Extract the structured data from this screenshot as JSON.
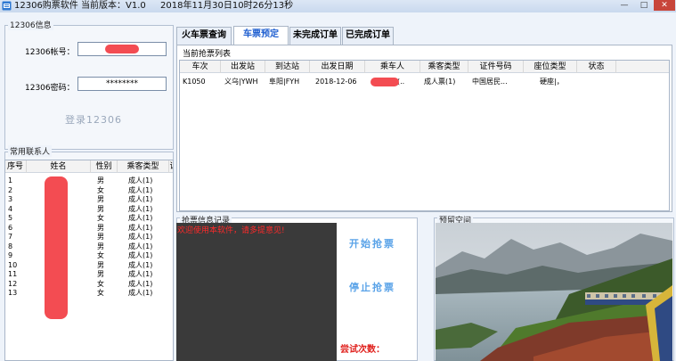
{
  "window": {
    "title": "12306购票软件 当前版本：V1.0",
    "datetime": "2018年11月30日10时26分13秒",
    "min": "—",
    "max": "□",
    "close": "✕"
  },
  "login": {
    "group_title": "12306信息",
    "account_label": "12306帐号：",
    "password_label": "12306密码：",
    "password_value": "********",
    "login_button": "登录12306"
  },
  "contacts": {
    "group_title": "常用联系人",
    "headers": [
      "序号",
      "姓名",
      "性别",
      "乘客类型",
      "证"
    ],
    "rows": [
      {
        "no": "1",
        "gender": "男",
        "type": "成人(1)"
      },
      {
        "no": "2",
        "gender": "女",
        "type": "成人(1)"
      },
      {
        "no": "3",
        "gender": "男",
        "type": "成人(1)"
      },
      {
        "no": "4",
        "gender": "男",
        "type": "成人(1)"
      },
      {
        "no": "5",
        "gender": "女",
        "type": "成人(1)"
      },
      {
        "no": "6",
        "gender": "男",
        "type": "成人(1)"
      },
      {
        "no": "7",
        "gender": "男",
        "type": "成人(1)"
      },
      {
        "no": "8",
        "gender": "男",
        "type": "成人(1)"
      },
      {
        "no": "9",
        "gender": "女",
        "type": "成人(1)"
      },
      {
        "no": "10",
        "gender": "男",
        "type": "成人(1)"
      },
      {
        "no": "11",
        "gender": "男",
        "type": "成人(1)"
      },
      {
        "no": "12",
        "gender": "女",
        "type": "成人(1)"
      },
      {
        "no": "13",
        "gender": "女",
        "type": "成人(1)"
      }
    ]
  },
  "tabs": [
    {
      "label": "火车票查询"
    },
    {
      "label": "车票预定"
    },
    {
      "label": "未完成订单"
    },
    {
      "label": "已完成订单"
    }
  ],
  "booking": {
    "list_title": "当前抢票列表",
    "headers": [
      "车次",
      "出发站",
      "到达站",
      "出发日期",
      "乘车人",
      "乘客类型",
      "证件号码",
      "座位类型",
      "状态"
    ],
    "row": {
      "train": "K1050",
      "from": "义乌|YWH",
      "to": "阜阳|FYH",
      "date": "2018-12-06",
      "passenger": "(..",
      "ptype": "成人票(1)",
      "idtype": "中国居民...",
      "seat": "硬座|，",
      "status": ""
    }
  },
  "log": {
    "group_title": "抢票信息记录",
    "message": "欢迎使用本软件，请多提意见!",
    "start_button": "开始抢票",
    "stop_button": "停止抢票",
    "tries_label": "尝试次数："
  },
  "reserve": {
    "group_title": "预留空间"
  }
}
